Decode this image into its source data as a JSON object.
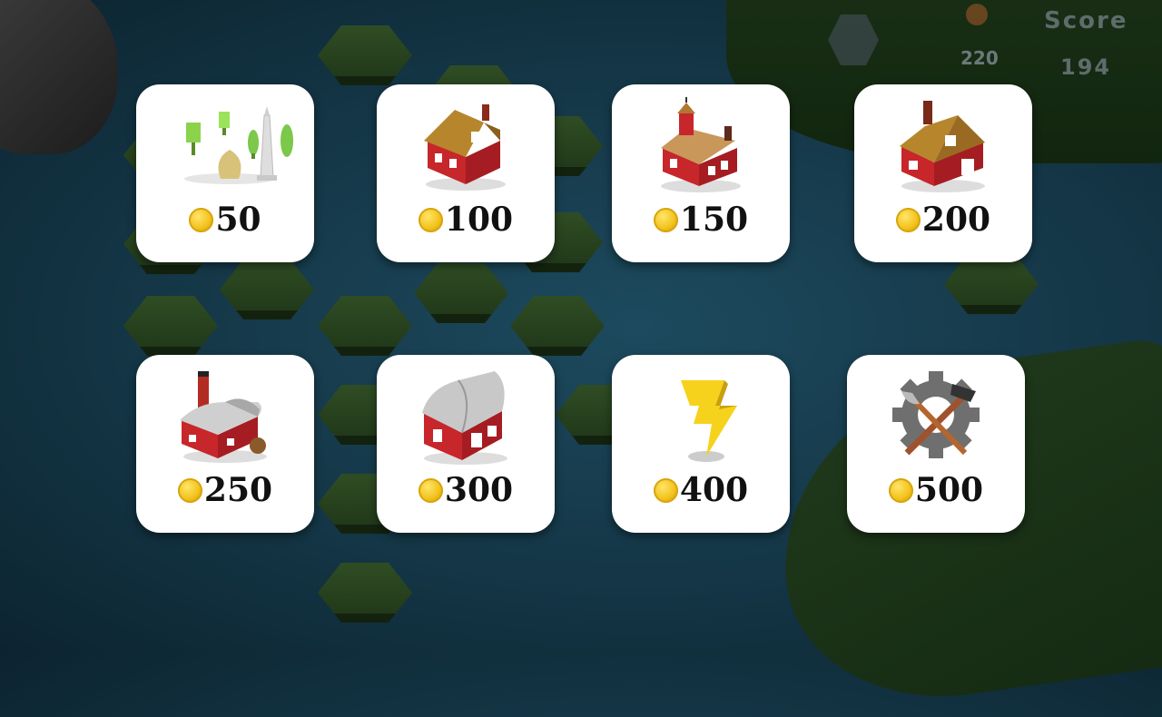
{
  "hud": {
    "coins": "220",
    "score_label": "Score",
    "score": "194"
  },
  "shop": {
    "items": [
      {
        "id": "trees",
        "icon": "trees-monument-icon",
        "price": "50"
      },
      {
        "id": "house-small",
        "icon": "small-house-icon",
        "price": "100"
      },
      {
        "id": "house-bell",
        "icon": "bell-tower-house-icon",
        "price": "150"
      },
      {
        "id": "barn-small",
        "icon": "small-barn-icon",
        "price": "200"
      },
      {
        "id": "silo-barn",
        "icon": "silo-barn-icon",
        "price": "250"
      },
      {
        "id": "big-barn",
        "icon": "big-barn-icon",
        "price": "300"
      },
      {
        "id": "lightning",
        "icon": "lightning-icon",
        "price": "400"
      },
      {
        "id": "tools",
        "icon": "tools-gear-icon",
        "price": "500"
      }
    ]
  },
  "colors": {
    "water": "#143646",
    "card": "#ffffff",
    "coin": "#f2c21b",
    "barn_red": "#c7262b"
  }
}
